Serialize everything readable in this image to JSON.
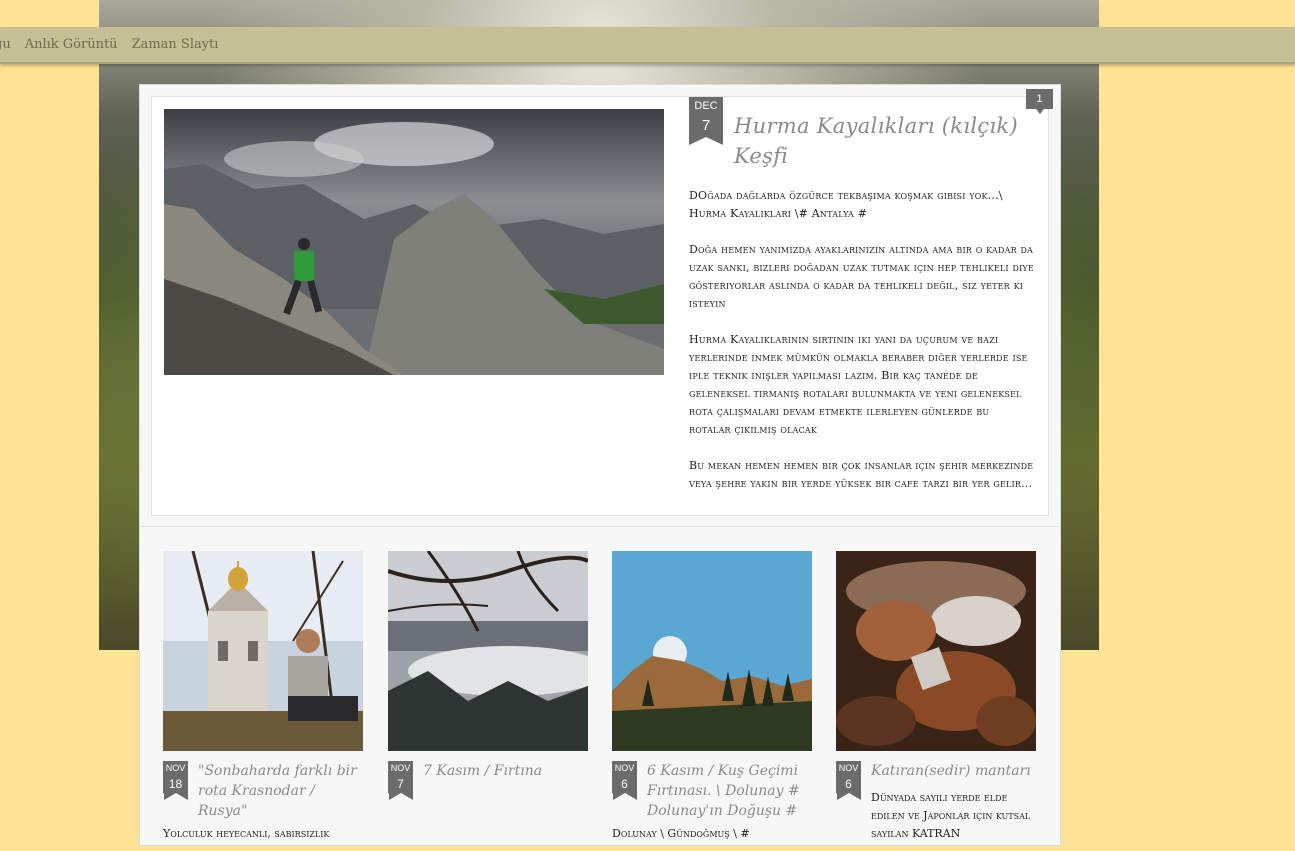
{
  "nav": {
    "items": [
      "ğu",
      "Anlık Görüntü",
      "Zaman Slaytı"
    ]
  },
  "featured": {
    "date": {
      "month": "DEC",
      "day": "7"
    },
    "title": "Hurma Kayalıkları (kılçık) Keşfi",
    "comments": "1",
    "excerpt": [
      "DOğada dağlarda özgürce tekbaşıma koşmak gibisi yok...\\ Hurma Kayalıkları \\# Antalya #",
      "Doğa hemen yanımızda ayaklarınızın altında ama bir o kadar da uzak sankı, bizleri doğadan uzak tutmak için hep tehlikeli diye gösteriyorlar aslında o kadar da tehlikeli değil, siz yeter ki isteyin",
      "Hurma Kayalıklarının sırtının iki yanı da uçurum ve bazı yerlerinde inmek mümkün olmakla beraber diğer yerlerde ise iple teknik inişler yapılması lazım. Bir kaç tanede de geleneksel tırmanış rotaları bulunmakta ve yeni geleneksel rota çalışmaları devam etmekte ilerleyen günlerde bu rotalar çıkılmış olacak",
      "Bu mekan hemen hemen bir çok insanlar için şehir merkezinde veya şehre yakın bir yerde yüksek bir  cafe tarzı bir yer gelir..."
    ]
  },
  "cards": [
    {
      "month": "NOV",
      "day": "18",
      "title": "\"Sonbaharda farklı bir rota Krasnodar / Rusya\"",
      "excerpt": "Yolculuk  heyecanlı, sabırsızlık"
    },
    {
      "month": "NOV",
      "day": "7",
      "title": "7 Kasım / Fırtına",
      "excerpt": ""
    },
    {
      "month": "NOV",
      "day": "6",
      "title": "6 Kasım / Kuş Geçimi Fırtınası. \\ Dolunay # Dolunay'ın Doğuşu #",
      "excerpt": "Dolunay \\ Gündoğmuş \\ #"
    },
    {
      "month": "NOV",
      "day": "6",
      "title": "Katıran(sedir) mantarı",
      "excerpt": "Dünyada sayılı yerde elde edilen ve Japonlar için kutsal sayılan KATRAN"
    }
  ]
}
